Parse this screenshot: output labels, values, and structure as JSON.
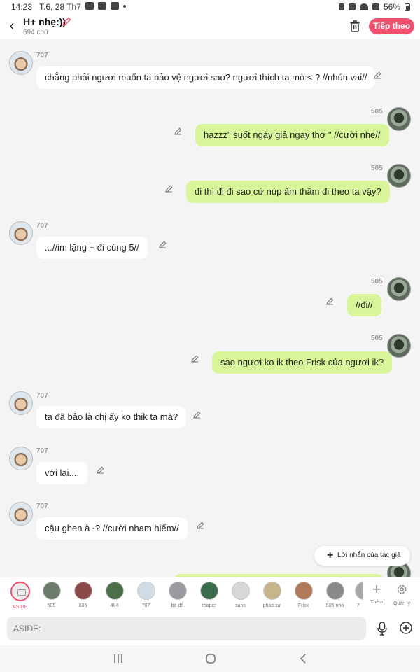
{
  "status_bar": {
    "time": "14:23",
    "date": "T.6, 28 Th7",
    "battery": "56%"
  },
  "header": {
    "title": "H+ nhẹ:))",
    "word_count": "694 chữ",
    "next_button": "Tiếp theo",
    "accent_color": "#f0506e"
  },
  "messages": [
    {
      "sender": "707",
      "side": "in",
      "text": "chẳng phải ngươi muốn ta bảo vệ ngươi sao? ngươi thích ta mò:< ? //nhún vai//"
    },
    {
      "sender": "505",
      "side": "out",
      "text": "hazzz\" suốt ngày giả ngay thơ \" //cười nhẹ//"
    },
    {
      "sender": "505",
      "side": "out",
      "text": "đi thì đi đi sao cứ núp âm thầm đi theo ta vậy?"
    },
    {
      "sender": "707",
      "side": "in",
      "text": "...//im lặng + đi cùng 5//"
    },
    {
      "sender": "505",
      "side": "out",
      "text": "//đi//"
    },
    {
      "sender": "505",
      "side": "out",
      "text": "sao ngươi ko ik theo Frisk của ngươi ik?"
    },
    {
      "sender": "707",
      "side": "in",
      "text": "ta đã bảo là chị ấy ko thik ta mà?"
    },
    {
      "sender": "707",
      "side": "in",
      "text": "với lại...."
    },
    {
      "sender": "707",
      "side": "in",
      "text": "cậu ghen à~? //cười nham hiểm//"
    }
  ],
  "author_note_button": "Lời nhắn của tác giả",
  "characters": [
    {
      "name": "ASIDE",
      "active": true,
      "color": "#eeeeee"
    },
    {
      "name": "505",
      "color": "#6b7a6a"
    },
    {
      "name": "606",
      "color": "#8b4a4a"
    },
    {
      "name": "404",
      "color": "#4c6f4a"
    },
    {
      "name": "707",
      "color": "#cfdce6"
    },
    {
      "name": "bà dê",
      "color": "#9a9aa0"
    },
    {
      "name": "reaper",
      "color": "#3a6b4a"
    },
    {
      "name": "sans",
      "color": "#d8d8d8"
    },
    {
      "name": "pháp sư",
      "color": "#c8b48a"
    },
    {
      "name": "Frisk",
      "color": "#b07a5a"
    },
    {
      "name": "505 nhỏ",
      "color": "#8a8a8a"
    },
    {
      "name": "7",
      "color": "#aaaaaa"
    }
  ],
  "tools": {
    "add_label": "Thêm",
    "manage_label": "Quản lý"
  },
  "input": {
    "placeholder": "ASIDE:"
  }
}
